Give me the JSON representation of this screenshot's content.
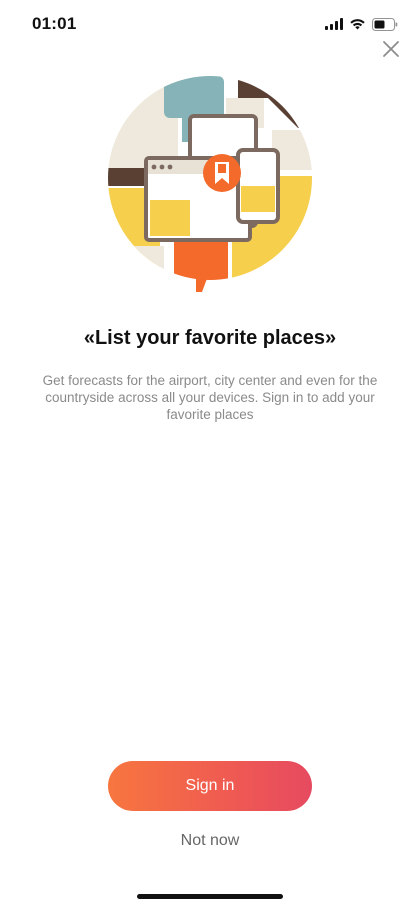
{
  "status_bar": {
    "time": "01:01",
    "icons": [
      "signal-icon",
      "wifi-icon",
      "battery-icon"
    ]
  },
  "close_icon": "close-icon",
  "illustration": {
    "icon": "bookmark-icon",
    "colors": {
      "orange": "#f36a2b",
      "yellow": "#f6cf4d",
      "teal": "#85b3b7",
      "brown": "#5a3f33",
      "cream": "#eee9dc",
      "device": "#7c6a60"
    }
  },
  "title": "«List your favorite places»",
  "description": "Get forecasts for the airport, city center and even for the countryside across all your devices. Sign in to add your favorite places",
  "buttons": {
    "sign_in": "Sign in",
    "not_now": "Not now"
  },
  "colors": {
    "button_gradient_start": "#f7763f",
    "button_gradient_end": "#e64a60",
    "description_text": "#8a8a8a"
  }
}
